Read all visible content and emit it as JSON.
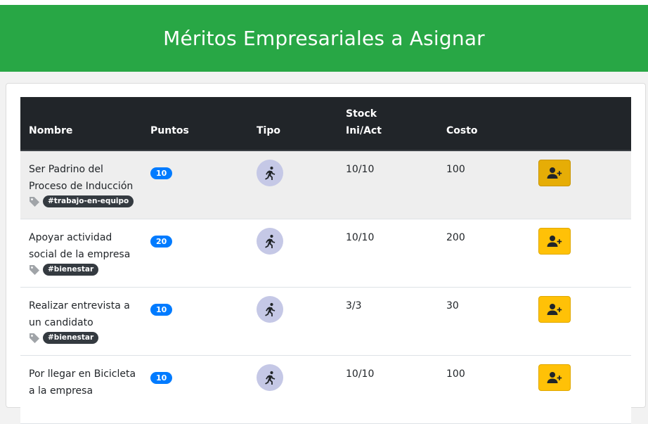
{
  "header": {
    "title": "Méritos Empresariales a Asignar"
  },
  "table": {
    "columns": {
      "nombre": "Nombre",
      "puntos": "Puntos",
      "tipo": "Tipo",
      "stock_line1": "Stock",
      "stock_line2": "Ini/Act",
      "costo": "Costo"
    },
    "rows": [
      {
        "name": "Ser Padrino del Proceso de Inducción",
        "tag": "#trabajo-en-equipo",
        "points": "10",
        "type_icon": "running-person-icon",
        "stock": "10/10",
        "cost": "100",
        "action_icon": "user-plus-icon"
      },
      {
        "name": "Apoyar actividad social de la empresa",
        "tag": "#bienestar",
        "points": "20",
        "type_icon": "running-person-icon",
        "stock": "10/10",
        "cost": "200",
        "action_icon": "user-plus-icon"
      },
      {
        "name": "Realizar entrevista a un candidato",
        "tag": "#bienestar",
        "points": "10",
        "type_icon": "running-person-icon",
        "stock": "3/3",
        "cost": "30",
        "action_icon": "user-plus-icon"
      },
      {
        "name": "Por llegar en Bicicleta a la empresa",
        "tag": "",
        "points": "10",
        "type_icon": "running-person-icon",
        "stock": "10/10",
        "cost": "100",
        "action_icon": "user-plus-icon"
      }
    ]
  },
  "colors": {
    "header_bg": "#28a745",
    "table_head_bg": "#212529",
    "points_badge": "#007bff",
    "action_button": "#ffc107",
    "tag_bg": "#343a40"
  }
}
